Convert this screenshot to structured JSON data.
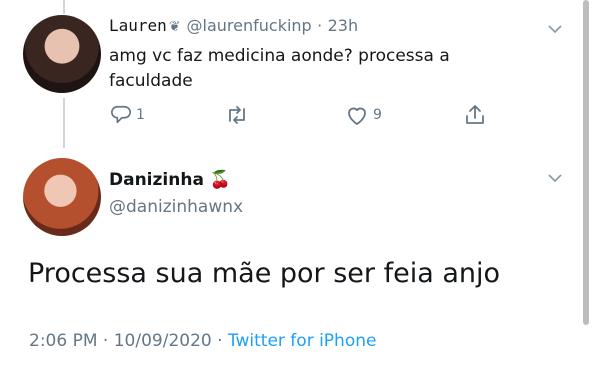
{
  "tweet_reply_to": {
    "display_name": "Lauren",
    "display_name_deco": "❦",
    "handle": "@laurenfuckinp",
    "separator": "·",
    "time": "23h",
    "text": "amg vc faz medicina aonde? processa a faculdade",
    "reply_count": "1",
    "retweet_count": "",
    "like_count": "9"
  },
  "tweet_main": {
    "display_name": "Danizinha",
    "display_name_emoji": "🍒",
    "handle": "@danizinhawnx",
    "text": "Processa sua mãe por ser feia anjo",
    "time": "2:06 PM",
    "separator": "·",
    "date": "10/09/2020",
    "source": "Twitter for iPhone"
  },
  "icons": [
    "chevron-down-icon",
    "reply-icon",
    "retweet-icon",
    "like-icon",
    "share-icon"
  ],
  "colors": {
    "text_primary": "#14171a",
    "text_secondary": "#657786",
    "link": "#1da1f2",
    "thread_line": "#ccd6dd"
  }
}
